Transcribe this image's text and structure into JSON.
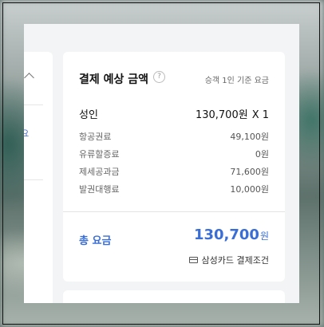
{
  "left_panel": {
    "link_text": "소요",
    "sub_text": "›"
  },
  "summary": {
    "title": "결제 예상 금액",
    "help_icon": "?",
    "subtitle": "승객 1인 기준 요금",
    "passenger_type": "성인",
    "passenger_price": "130,700원",
    "passenger_count": "X 1",
    "fees": [
      {
        "label": "항공권료",
        "value": "49,100원"
      },
      {
        "label": "유류할증료",
        "value": "0원"
      },
      {
        "label": "제세공과금",
        "value": "71,600원"
      },
      {
        "label": "발권대행료",
        "value": "10,000원"
      }
    ],
    "total_label": "총 요금",
    "total_amount": "130,700",
    "total_unit": "원",
    "card_condition": "삼성카드 결제조건"
  },
  "colors": {
    "accent": "#3b6ed4",
    "card_bg": "#ffffff",
    "panel_bg": "#f3f4f6"
  }
}
